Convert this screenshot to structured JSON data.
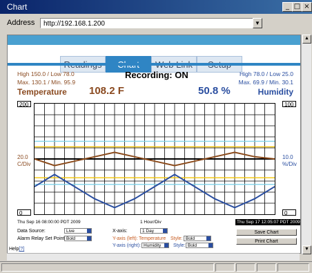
{
  "window": {
    "title": "Chart",
    "minimize_icon": "minimize-icon",
    "restore_icon": "restore-icon",
    "close_icon": "close-icon"
  },
  "address_bar": {
    "label": "Address",
    "url": "http://192.168.1.200"
  },
  "tabs": [
    {
      "label": "Readings",
      "active": false
    },
    {
      "label": "Chart",
      "active": true
    },
    {
      "label": "Web Link",
      "active": false
    },
    {
      "label": "Setup",
      "active": false
    }
  ],
  "header": {
    "temp_high_low": "High 150.0 / Low 78.0",
    "temp_max_min": "Max. 130.1 / Min. 95.9",
    "temp_label": "Temperature",
    "temp_value": "108.2 F",
    "status": "Recording: ON",
    "hum_high_low": "High 78.0 / Low 25.0",
    "hum_max_min": "Max. 69.9 / Min. 30.1",
    "hum_label": "Humidity",
    "hum_value": "50.8 %"
  },
  "axes": {
    "left_top": "200",
    "left_bottom": "0",
    "left_scale_value": "20.0",
    "left_scale_unit": "C/Div",
    "right_top": "100",
    "right_bottom": "0",
    "right_scale_value": "10.0",
    "right_scale_unit": "%/Div",
    "start_time": "Thu Sep 16 08:00:00 PDT 2009",
    "x_scale": "1 Hour/Div",
    "end_time": "Thu Sep 17 12:05:07 PDT 2009"
  },
  "chart_data": {
    "type": "line",
    "x": [
      0,
      2,
      4,
      6,
      8,
      10,
      12,
      14,
      16,
      18,
      20,
      22,
      24
    ],
    "series": [
      {
        "values": [
          100,
          88,
          96,
          104,
          112,
          104,
          96,
          88,
          96,
          104,
          112,
          104,
          100
        ],
        "color": "#8b4a1a"
      },
      {
        "values": [
          50,
          72,
          50,
          28,
          12,
          28,
          50,
          72,
          50,
          28,
          12,
          28,
          50
        ],
        "color": "#2a4ea0"
      }
    ],
    "ylim": [
      0,
      200
    ],
    "grid": true,
    "colors": {
      "temp_line": "#8b4a1a",
      "hum_line": "#2a4ea0",
      "alarm_yellow": "#f5c400",
      "alarm_cyan": "#7fd3ea"
    }
  },
  "controls": {
    "data_source_label": "Data Source:",
    "data_source_value": "Live",
    "alarm_label": "Alarm Relay Set Points:",
    "alarm_value": "Bold",
    "xaxis_label": "X-axis:",
    "xaxis_value": "1 Day",
    "yleft_label": "Y-axis (left):",
    "yleft_value": "Temperature",
    "yleft_style_label": "Style:",
    "yleft_style_value": "Bold",
    "yright_label": "Y-axis (right):",
    "yright_value": "Humidity",
    "yright_style_label": "Style:",
    "yright_style_value": "Bold",
    "save_chart": "Save Chart",
    "print_chart": "Print Chart",
    "help_label": "Help",
    "help_link": "[?]"
  }
}
